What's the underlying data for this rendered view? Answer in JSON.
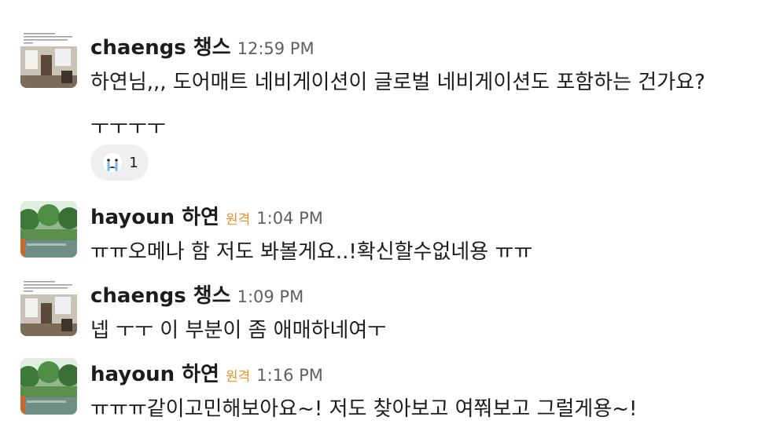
{
  "messages": [
    {
      "name": "chaengs 챙스",
      "time": "12:59 PM",
      "lines": [
        "하연님,,, 도어매트 네비게이션이 글로벌 네비게이션도 포함하는 건가요?",
        "ㅜㅜㅜㅜ"
      ],
      "reaction": {
        "emoji": "crying-face-icon",
        "count": "1"
      }
    },
    {
      "name": "hayoun 하연",
      "badge": "원격",
      "time": "1:04 PM",
      "lines": [
        "ㅠㅠ오메나 함 저도 봐볼게요..!확신할수없네용 ㅠㅠ"
      ]
    },
    {
      "name": "chaengs 챙스",
      "time": "1:09 PM",
      "lines": [
        "넵 ㅜㅜ 이 부분이 좀 애매하네여ㅜ"
      ]
    },
    {
      "name": "hayoun 하연",
      "badge": "원격",
      "time": "1:16 PM",
      "lines": [
        "ㅠㅠㅠ같이고민해보아요~! 저도 찾아보고 여쭤보고 그럴게용~!"
      ]
    }
  ],
  "avatars": {
    "chaengs": "room-photo-avatar",
    "hayoun": "forest-river-avatar"
  },
  "colors": {
    "badge": "#e8912d",
    "time": "#616061",
    "text": "#1d1c1d",
    "reaction_bg": "#efefef"
  }
}
